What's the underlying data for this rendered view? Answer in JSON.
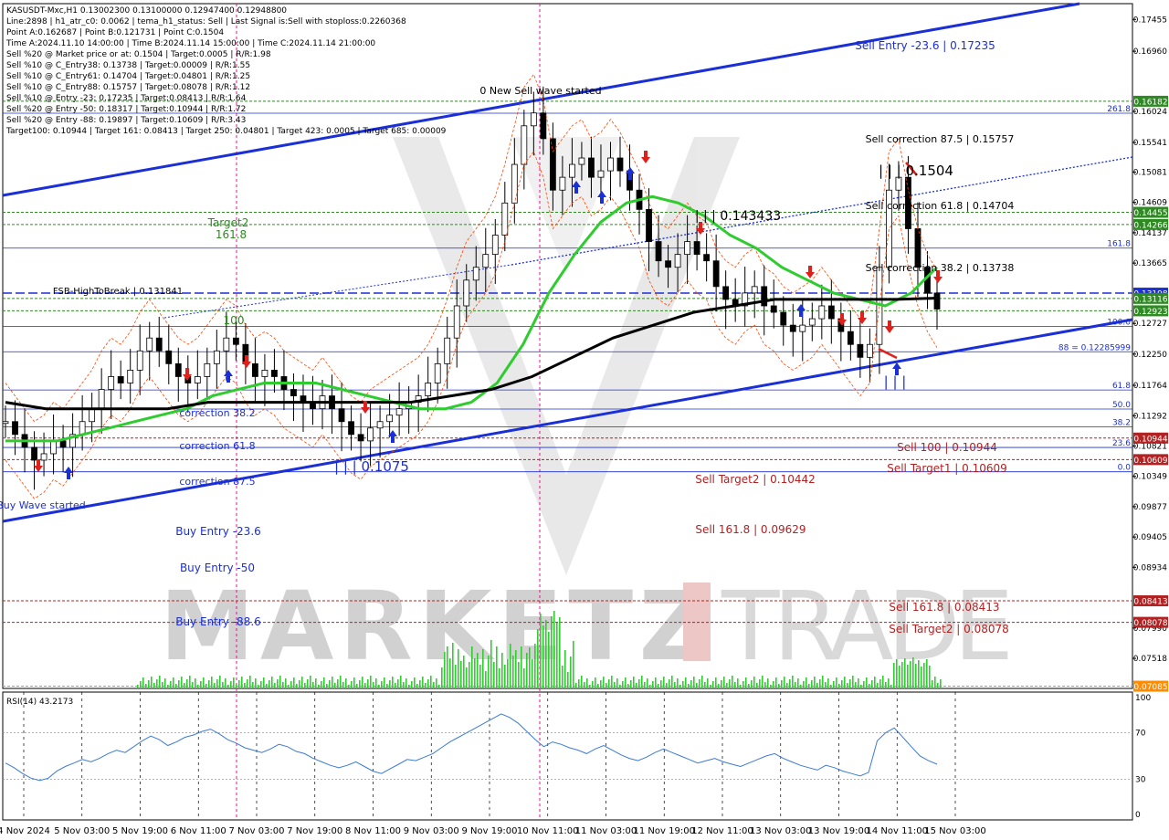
{
  "header": {
    "lines": [
      "KASUSDT-Mxc,H1  0.13002300 0.13100000 0.12947400 0.12948800",
      "Line:2898 | h1_atr_c0: 0.0062 | tema_h1_status: Sell | Last Signal is:Sell with stoploss:0.2260368",
      "Point A:0.162687 | Point B:0.121731 | Point C:0.1504",
      "Time A:2024.11.10 14:00:00 | Time B:2024.11.14 15:00:00 | Time C:2024.11.14 21:00:00",
      "Sell %20 @ Market price or at: 0.1504 | Target:0.0005 | R/R:1.98",
      "Sell %10 @ C_Entry38: 0.13738 | Target:0.00009 | R/R:1.55",
      "Sell %10 @ C_Entry61: 0.14704 | Target:0.04801 | R/R:1.25",
      "Sell %10 @ C_Entry88: 0.15757 | Target:0.08078 | R/R:1.12",
      "Sell %10 @ Entry -23: 0.17235 | Target:0.08413 | R/R:1.64",
      "Sell %20 @ Entry -50: 0.18317 | Target:0.10944 | R/R:1.72",
      "Sell %20 @ Entry -88: 0.19897 | Target:0.10609 | R/R:3.43",
      "Target100: 0.10944 | Target 161: 0.08413 | Target 250: 0.04801 | Target 423: 0.0005 | Target 685: 0.00009"
    ]
  },
  "watermark": {
    "left": "MARKETZ",
    "right": "TRADE"
  },
  "colors": {
    "bull": "#000000",
    "ma_green": "#2ecc2e",
    "ma_black": "#000000",
    "channel": "#1b2fd6",
    "red": "#b22222",
    "blue_text": "#1b2fd6",
    "green_text": "#2e8b22",
    "rsi": "#3a7bd5",
    "volume": "#33cc33"
  },
  "price_axis": {
    "ticks": [
      "0.17455",
      "0.16960",
      "0.16024",
      "0.15541",
      "0.15081",
      "0.14609",
      "0.14137",
      "0.13665",
      "0.12727",
      "0.12250",
      "0.11764",
      "0.11292",
      "0.10821",
      "0.10349",
      "0.09877",
      "0.09405",
      "0.08934",
      "0.07990",
      "0.07518"
    ],
    "badges": [
      {
        "text": "0.16182",
        "color": "#2e8b22"
      },
      {
        "text": "0.14455",
        "color": "#2e8b22"
      },
      {
        "text": "0.14266",
        "color": "#2e8b22"
      },
      {
        "text": "0.13198",
        "color": "#1b2fd6"
      },
      {
        "text": "0.13116",
        "color": "#2e8b22"
      },
      {
        "text": "0.12923",
        "color": "#2e8b22"
      },
      {
        "text": "0.10944",
        "color": "#b22222"
      },
      {
        "text": "0.10609",
        "color": "#b22222"
      },
      {
        "text": "0.08413",
        "color": "#b22222"
      },
      {
        "text": "0.08078",
        "color": "#b22222"
      },
      {
        "text": "0.07085",
        "color": "#ff8c00"
      }
    ]
  },
  "time_axis": [
    "4 Nov 2024",
    "5 Nov 03:00",
    "5 Nov 19:00",
    "6 Nov 11:00",
    "7 Nov 03:00",
    "7 Nov 19:00",
    "8 Nov 11:00",
    "9 Nov 03:00",
    "9 Nov 19:00",
    "10 Nov 11:00",
    "11 Nov 03:00",
    "11 Nov 19:00",
    "12 Nov 11:00",
    "13 Nov 03:00",
    "13 Nov 19:00",
    "14 Nov 11:00",
    "15 Nov 03:00"
  ],
  "annotations": {
    "sell_entry_236": "Sell Entry -23.6 | 0.17235",
    "new_sell_wave": "0 New Sell wave started",
    "sell_corr_875": "Sell correction 87.5 | 0.15757",
    "point_c": "| | | 0.1504",
    "sell_corr_618": "Sell correction 61.8 | 0.14704",
    "mid_value": "| | | 0.143433",
    "sell_corr_382": "Sell correction 38.2 | 0.13738",
    "target2": "Target2",
    "target2_sub": "161.8",
    "fsb": "FSB-HighToBreak | 0.131841",
    "l100": "100",
    "corr_382": "correction 38.2",
    "corr_618": "correction 61.8",
    "corr_875": "correction 87.5",
    "low_val": "| | | 0.1075",
    "buy_wave": "Buy Wave started",
    "buy_entry_236": "Buy Entry -23.6",
    "buy_entry_50": "Buy Entry -50",
    "buy_entry_886": "Buy Entry -88.6",
    "sell_100": "Sell 100 | 0.10944",
    "sell_target1": "Sell Target1 | 0.10609",
    "sell_target2": "Sell Target2 | 0.10442",
    "sell_1618": "Sell 161.8 | 0.09629",
    "sell_1618b": "Sell 161.8 | 0.08413",
    "sell_target2b": "Sell Target2 | 0.08078",
    "pointb_mark": "| | |",
    "fib_levels": [
      "261.8",
      "161.8",
      "100.0",
      "88 = 0.12285999",
      "61.8",
      "50.0",
      "38.2",
      "23.6",
      "0.0"
    ]
  },
  "rsi": {
    "label": "RSI(14) 43.2173",
    "levels": [
      "100",
      "70",
      "30",
      "0"
    ],
    "values": [
      44,
      40,
      35,
      31,
      29,
      31,
      37,
      41,
      44,
      47,
      45,
      48,
      52,
      55,
      53,
      58,
      63,
      67,
      64,
      59,
      62,
      66,
      68,
      71,
      73,
      69,
      64,
      61,
      57,
      55,
      53,
      56,
      60,
      58,
      54,
      52,
      48,
      45,
      42,
      40,
      42,
      45,
      41,
      37,
      35,
      39,
      43,
      47,
      46,
      49,
      52,
      57,
      62,
      66,
      70,
      74,
      78,
      82,
      86,
      83,
      78,
      71,
      64,
      58,
      62,
      60,
      57,
      55,
      52,
      56,
      59,
      55,
      51,
      48,
      46,
      49,
      53,
      56,
      53,
      50,
      47,
      44,
      46,
      48,
      45,
      43,
      41,
      44,
      47,
      50,
      52,
      48,
      45,
      42,
      40,
      38,
      42,
      40,
      37,
      35,
      33,
      36,
      63,
      70,
      74,
      66,
      58,
      50,
      46,
      43
    ]
  },
  "chart_data": {
    "type": "candlestick",
    "symbol": "KASUSDT-Mxc",
    "timeframe": "H1",
    "ohlc_last": {
      "open": 0.130023,
      "high": 0.131,
      "low": 0.129474,
      "close": 0.129488
    },
    "x_labels": [
      "4 Nov 2024",
      "5 Nov 03:00",
      "5 Nov 19:00",
      "6 Nov 11:00",
      "7 Nov 03:00",
      "7 Nov 19:00",
      "8 Nov 11:00",
      "9 Nov 03:00",
      "9 Nov 19:00",
      "10 Nov 11:00",
      "11 Nov 03:00",
      "11 Nov 19:00",
      "12 Nov 11:00",
      "13 Nov 03:00",
      "13 Nov 19:00",
      "14 Nov 11:00",
      "15 Nov 03:00"
    ],
    "ylim": [
      0.0705,
      0.177
    ],
    "close_series": [
      0.112,
      0.11,
      0.108,
      0.106,
      0.107,
      0.109,
      0.108,
      0.11,
      0.112,
      0.114,
      0.117,
      0.119,
      0.118,
      0.12,
      0.123,
      0.125,
      0.123,
      0.121,
      0.119,
      0.118,
      0.119,
      0.121,
      0.123,
      0.125,
      0.124,
      0.121,
      0.119,
      0.12,
      0.119,
      0.117,
      0.116,
      0.115,
      0.114,
      0.116,
      0.114,
      0.112,
      0.11,
      0.109,
      0.111,
      0.112,
      0.113,
      0.114,
      0.115,
      0.116,
      0.118,
      0.121,
      0.125,
      0.13,
      0.134,
      0.136,
      0.138,
      0.141,
      0.146,
      0.152,
      0.158,
      0.16,
      0.156,
      0.148,
      0.15,
      0.152,
      0.153,
      0.15,
      0.151,
      0.153,
      0.151,
      0.148,
      0.145,
      0.14,
      0.137,
      0.136,
      0.138,
      0.14,
      0.138,
      0.137,
      0.133,
      0.131,
      0.13,
      0.132,
      0.133,
      0.13,
      0.129,
      0.127,
      0.126,
      0.127,
      0.128,
      0.13,
      0.128,
      0.126,
      0.124,
      0.122,
      0.124,
      0.136,
      0.148,
      0.15,
      0.142,
      0.136,
      0.132,
      0.1295
    ],
    "ma_green": [
      0.109,
      0.109,
      0.109,
      0.11,
      0.111,
      0.112,
      0.113,
      0.114,
      0.116,
      0.117,
      0.118,
      0.118,
      0.118,
      0.117,
      0.116,
      0.115,
      0.114,
      0.114,
      0.115,
      0.118,
      0.124,
      0.132,
      0.138,
      0.143,
      0.146,
      0.147,
      0.146,
      0.144,
      0.141,
      0.139,
      0.136,
      0.134,
      0.132,
      0.131,
      0.13,
      0.132,
      0.136
    ],
    "ma_black": [
      0.115,
      0.114,
      0.114,
      0.114,
      0.114,
      0.115,
      0.115,
      0.115,
      0.115,
      0.115,
      0.115,
      0.116,
      0.117,
      0.119,
      0.122,
      0.125,
      0.127,
      0.129,
      0.13,
      0.131,
      0.131,
      0.131,
      0.131,
      0.1312
    ],
    "horizontal_levels": [
      0.16182,
      0.14455,
      0.14266,
      0.13198,
      0.13116,
      0.12923,
      0.10944,
      0.10609,
      0.08413,
      0.08078,
      0.07085
    ]
  }
}
